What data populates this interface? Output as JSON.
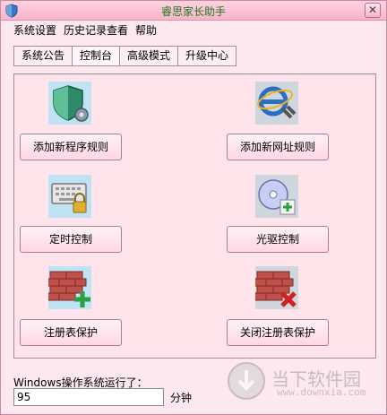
{
  "window": {
    "title": "睿思家长助手",
    "close_glyph": "✕"
  },
  "menubar": {
    "items": [
      "系统设置",
      "历史记录查看",
      "帮助"
    ]
  },
  "tabs": [
    {
      "label": "系统公告"
    },
    {
      "label": "控制台"
    },
    {
      "label": "高级模式"
    },
    {
      "label": "升级中心"
    }
  ],
  "actions": [
    {
      "label": "添加新程序规则",
      "icon": "shield-gear-icon"
    },
    {
      "label": "添加新网址规则",
      "icon": "ie-wrench-icon"
    },
    {
      "label": "定时控制",
      "icon": "keyboard-lock-icon"
    },
    {
      "label": "光驱控制",
      "icon": "cd-drive-icon"
    },
    {
      "label": "注册表保护",
      "icon": "firewall-add-icon"
    },
    {
      "label": "关闭注册表保护",
      "icon": "firewall-remove-icon"
    }
  ],
  "uptime": {
    "label": "Windows操作系统运行了：",
    "value": "95",
    "unit": "分钟"
  },
  "watermark": {
    "title": "当下软件园",
    "subtitle": "www.downxia.com"
  },
  "colors": {
    "title_text": "#1d7a1d",
    "background": "#fde8ef",
    "panel": "#ffe4ec"
  }
}
